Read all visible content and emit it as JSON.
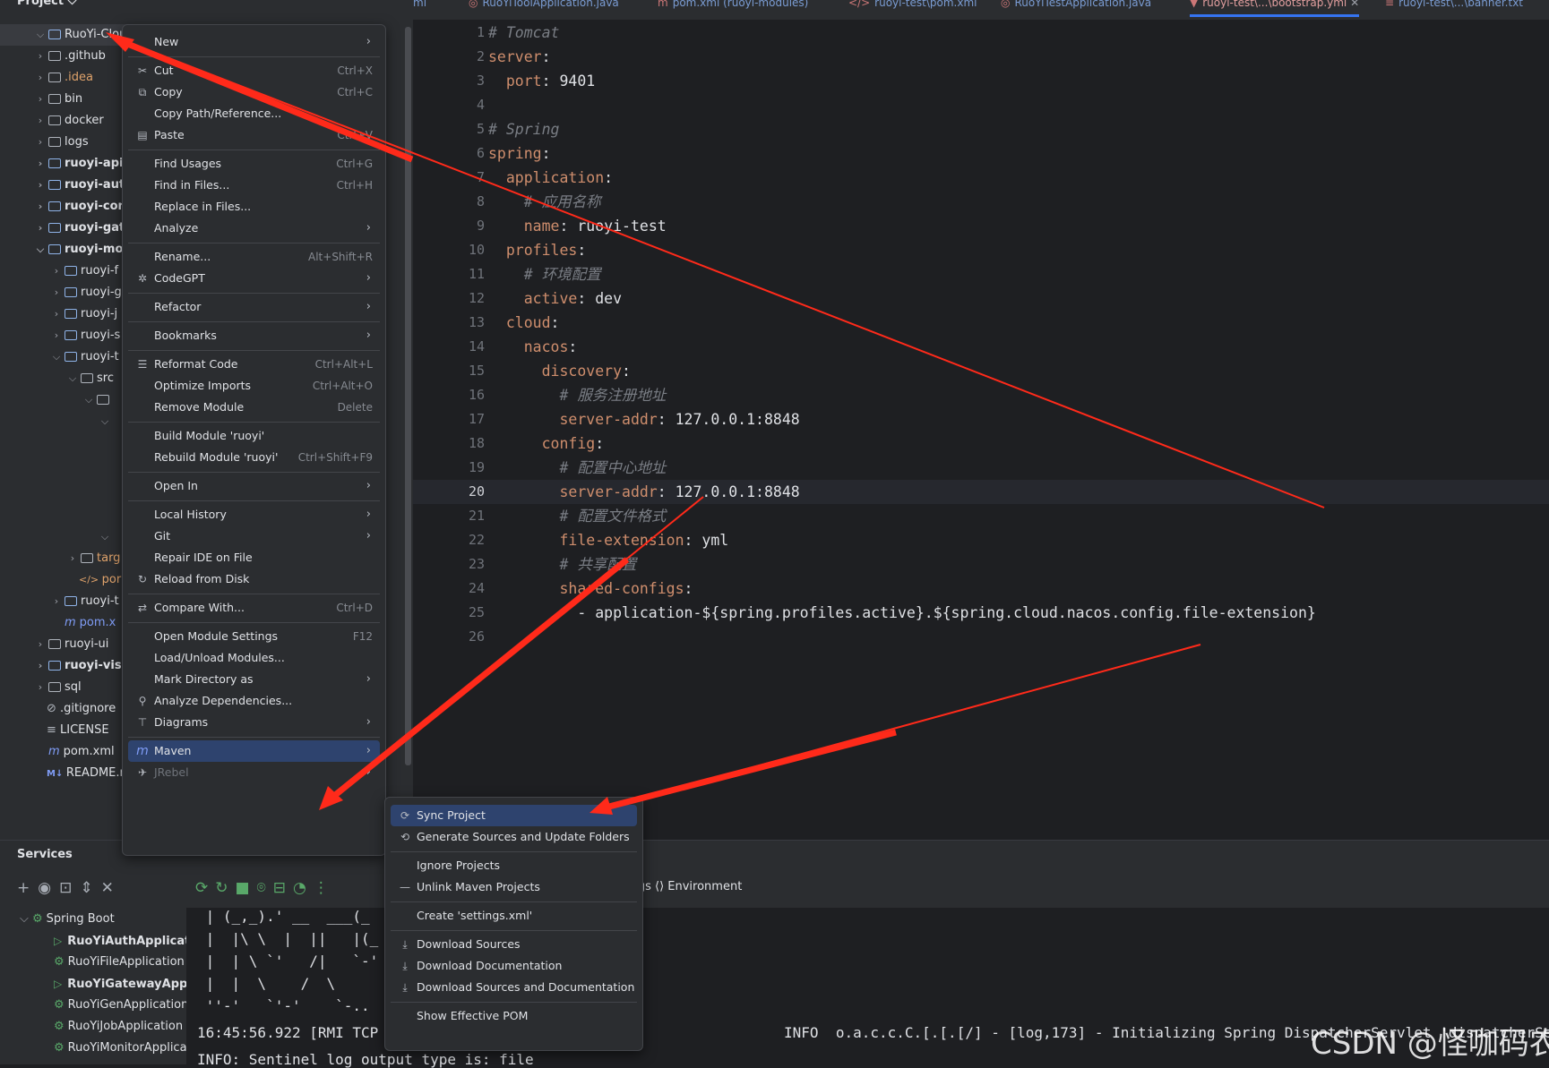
{
  "project": {
    "header": "Project",
    "tree": [
      {
        "label": "RuoYi-Cloud",
        "chev": "⌵",
        "bold": false,
        "type": "mod"
      },
      {
        "label": ".github",
        "chev": "›",
        "type": "dir"
      },
      {
        "label": ".idea",
        "chev": "›",
        "type": "dir",
        "color": "#e0a36b"
      },
      {
        "label": "bin",
        "chev": "›",
        "type": "dir"
      },
      {
        "label": "docker",
        "chev": "›",
        "type": "dir"
      },
      {
        "label": "logs",
        "chev": "›",
        "type": "dir"
      },
      {
        "label": "ruoyi-api",
        "chev": "›",
        "type": "mod",
        "bold": true
      },
      {
        "label": "ruoyi-aut",
        "chev": "›",
        "type": "mod",
        "bold": true
      },
      {
        "label": "ruoyi-con",
        "chev": "›",
        "type": "mod",
        "bold": true
      },
      {
        "label": "ruoyi-gat",
        "chev": "›",
        "type": "mod",
        "bold": true
      },
      {
        "label": "ruoyi-mo",
        "chev": "⌵",
        "type": "mod",
        "bold": true
      },
      {
        "label": "ruoyi-f",
        "chev": "›",
        "type": "mod",
        "indent": 1
      },
      {
        "label": "ruoyi-g",
        "chev": "›",
        "type": "mod",
        "indent": 1
      },
      {
        "label": "ruoyi-j",
        "chev": "›",
        "type": "mod",
        "indent": 1
      },
      {
        "label": "ruoyi-s",
        "chev": "›",
        "type": "mod",
        "indent": 1
      },
      {
        "label": "ruoyi-t",
        "chev": "⌵",
        "type": "mod",
        "indent": 1
      },
      {
        "label": "src",
        "chev": "⌵",
        "type": "dir",
        "indent": 2
      },
      {
        "label": "",
        "chev": "⌵",
        "type": "dir",
        "indent": 3
      },
      {
        "label": "",
        "chev": "⌵",
        "type": "none",
        "indent": 4
      }
    ],
    "tree_lower": [
      {
        "label": "",
        "chev": "⌵",
        "type": "none",
        "indent": 4
      },
      {
        "label": "targ",
        "chev": "›",
        "type": "dir",
        "indent": 2,
        "color": "#e0a36b"
      },
      {
        "label": "por",
        "chev": "",
        "type": "xml",
        "indent": 2,
        "color": "#e0a36b"
      },
      {
        "label": "ruoyi-t",
        "chev": "›",
        "type": "mod",
        "indent": 1
      },
      {
        "label": "pom.x",
        "chev": "",
        "type": "mvn",
        "indent": 1,
        "color": "#7f9cf5"
      },
      {
        "label": "ruoyi-ui",
        "chev": "›",
        "type": "dir"
      },
      {
        "label": "ruoyi-visu",
        "chev": "›",
        "type": "mod",
        "bold": true
      },
      {
        "label": "sql",
        "chev": "›",
        "type": "dir"
      },
      {
        "label": ".gitignore",
        "chev": "",
        "type": "ignore"
      },
      {
        "label": "LICENSE",
        "chev": "",
        "type": "text"
      },
      {
        "label": "pom.xml",
        "chev": "",
        "type": "mvn"
      },
      {
        "label": "README.r",
        "chev": "",
        "type": "md"
      }
    ]
  },
  "tabs": [
    {
      "label": "ml",
      "icon": ""
    },
    {
      "label": "RuoYiToolApplication.java",
      "icon": "◎"
    },
    {
      "label": "pom.xml (ruoyi-modules)",
      "icon": "m"
    },
    {
      "label": "ruoyi-test\\pom.xml",
      "icon": "</>"
    },
    {
      "label": "RuoYiTestApplication.java",
      "icon": "◎"
    },
    {
      "label": "ruoyi-test\\...\\bootstrap.yml",
      "icon": "▼",
      "active": true
    },
    {
      "label": "ruoyi-test\\...\\banner.txt",
      "icon": "≡"
    }
  ],
  "editor": {
    "current_line": "20",
    "lines": [
      [
        {
          "t": "# Tomcat",
          "c": "c"
        }
      ],
      [
        {
          "t": "server",
          "c": "k"
        },
        {
          "t": ":",
          "c": "v"
        }
      ],
      [
        {
          "t": "  port",
          "c": "k"
        },
        {
          "t": ": 9401",
          "c": "v"
        }
      ],
      [],
      [
        {
          "t": "# Spring",
          "c": "c"
        }
      ],
      [
        {
          "t": "spring",
          "c": "k"
        },
        {
          "t": ":",
          "c": "v"
        }
      ],
      [
        {
          "t": "  application",
          "c": "k"
        },
        {
          "t": ":",
          "c": "v"
        }
      ],
      [
        {
          "t": "    # 应用名称",
          "c": "c"
        }
      ],
      [
        {
          "t": "    name",
          "c": "k"
        },
        {
          "t": ": ruoyi-test",
          "c": "v"
        }
      ],
      [
        {
          "t": "  profiles",
          "c": "k"
        },
        {
          "t": ":",
          "c": "v"
        }
      ],
      [
        {
          "t": "    # 环境配置",
          "c": "c"
        }
      ],
      [
        {
          "t": "    active",
          "c": "k"
        },
        {
          "t": ": dev",
          "c": "v"
        }
      ],
      [
        {
          "t": "  cloud",
          "c": "k"
        },
        {
          "t": ":",
          "c": "v"
        }
      ],
      [
        {
          "t": "    nacos",
          "c": "k"
        },
        {
          "t": ":",
          "c": "v"
        }
      ],
      [
        {
          "t": "      discovery",
          "c": "k"
        },
        {
          "t": ":",
          "c": "v"
        }
      ],
      [
        {
          "t": "        # 服务注册地址",
          "c": "c"
        }
      ],
      [
        {
          "t": "        server-addr",
          "c": "k"
        },
        {
          "t": ": 127.0.0.1:8848",
          "c": "v"
        }
      ],
      [
        {
          "t": "      config",
          "c": "k"
        },
        {
          "t": ":",
          "c": "v"
        }
      ],
      [
        {
          "t": "        # 配置中心地址",
          "c": "c"
        }
      ],
      [
        {
          "t": "        server-addr",
          "c": "k"
        },
        {
          "t": ": 127.0.0.1:8848",
          "c": "v"
        }
      ],
      [
        {
          "t": "        # 配置文件格式",
          "c": "c"
        }
      ],
      [
        {
          "t": "        file-extension",
          "c": "k"
        },
        {
          "t": ": yml",
          "c": "v"
        }
      ],
      [
        {
          "t": "        # 共享配置",
          "c": "c"
        }
      ],
      [
        {
          "t": "        shared-configs",
          "c": "k"
        },
        {
          "t": ":",
          "c": "v"
        }
      ],
      [
        {
          "t": "          - application-${spring.profiles.active}.${spring.cloud.nacos.config.file-extension}",
          "c": "v"
        }
      ],
      []
    ]
  },
  "context_menu": {
    "items": [
      {
        "label": "New",
        "sub": true
      },
      {
        "sep": true
      },
      {
        "label": "Cut",
        "icon": "✂",
        "sc": "Ctrl+X"
      },
      {
        "label": "Copy",
        "icon": "⧉",
        "sc": "Ctrl+C"
      },
      {
        "label": "Copy Path/Reference..."
      },
      {
        "label": "Paste",
        "icon": "▤",
        "sc": "Ctrl+V"
      },
      {
        "sep": true
      },
      {
        "label": "Find Usages",
        "sc": "Ctrl+G"
      },
      {
        "label": "Find in Files...",
        "sc": "Ctrl+H"
      },
      {
        "label": "Replace in Files..."
      },
      {
        "label": "Analyze",
        "sub": true
      },
      {
        "sep": true
      },
      {
        "label": "Rename...",
        "sc": "Alt+Shift+R"
      },
      {
        "label": "CodeGPT",
        "icon": "✲",
        "sub": true
      },
      {
        "sep": true
      },
      {
        "label": "Refactor",
        "sub": true
      },
      {
        "sep": true
      },
      {
        "label": "Bookmarks",
        "sub": true
      },
      {
        "sep": true
      },
      {
        "label": "Reformat Code",
        "icon": "☰",
        "sc": "Ctrl+Alt+L"
      },
      {
        "label": "Optimize Imports",
        "sc": "Ctrl+Alt+O"
      },
      {
        "label": "Remove Module",
        "sc": "Delete"
      },
      {
        "sep": true
      },
      {
        "label": "Build Module 'ruoyi'"
      },
      {
        "label": "Rebuild Module 'ruoyi'",
        "sc": "Ctrl+Shift+F9"
      },
      {
        "sep": true
      },
      {
        "label": "Open In",
        "sub": true
      },
      {
        "sep": true
      },
      {
        "label": "Local History",
        "sub": true
      },
      {
        "label": "Git",
        "sub": true
      },
      {
        "label": "Repair IDE on File"
      },
      {
        "label": "Reload from Disk",
        "icon": "↻"
      },
      {
        "sep": true
      },
      {
        "label": "Compare With...",
        "icon": "⇄",
        "sc": "Ctrl+D"
      },
      {
        "sep": true
      },
      {
        "label": "Open Module Settings",
        "sc": "F12"
      },
      {
        "label": "Load/Unload Modules..."
      },
      {
        "label": "Mark Directory as",
        "sub": true
      },
      {
        "label": "Analyze Dependencies...",
        "icon": "⚲"
      },
      {
        "label": "Diagrams",
        "icon": "⊤",
        "sub": true
      },
      {
        "sep": true
      },
      {
        "label": "Maven",
        "icon": "m",
        "sub": true,
        "selected": true
      },
      {
        "label": "JRebel",
        "icon": "✈",
        "sub": true,
        "disabled": true
      }
    ]
  },
  "maven_menu": {
    "items": [
      {
        "label": "Sync Project",
        "icon": "⟳",
        "selected": true
      },
      {
        "label": "Generate Sources and Update Folders",
        "icon": "⟲"
      },
      {
        "sep": true
      },
      {
        "label": "Ignore Projects"
      },
      {
        "label": "Unlink Maven Projects",
        "icon": "—"
      },
      {
        "sep": true
      },
      {
        "label": "Create 'settings.xml'"
      },
      {
        "sep": true
      },
      {
        "label": "Download Sources",
        "icon": "⤓"
      },
      {
        "label": "Download Documentation",
        "icon": "⤓"
      },
      {
        "label": "Download Sources and Documentation",
        "icon": "⤓"
      },
      {
        "sep": true
      },
      {
        "label": "Show Effective POM"
      }
    ]
  },
  "services": {
    "title": "Services",
    "toolbar": "+◉⊡⇕✕",
    "toolbar2": "⟳↻■⌾⊟◔⋮",
    "tabs_text": "ings   ⟨⟩ Environment",
    "tree": [
      {
        "label": "Spring Boot",
        "chev": "⌵",
        "kind": "group"
      },
      {
        "label": "RuoYiAuthApplicatio",
        "kind": "run",
        "bold": true
      },
      {
        "label": "RuoYiFileApplication",
        "kind": "idle"
      },
      {
        "label": "RuoYiGatewayApplic",
        "kind": "run",
        "bold": true
      },
      {
        "label": "RuoYiGenApplication",
        "kind": "idle"
      },
      {
        "label": "RuoYiJobApplication",
        "kind": "idle"
      },
      {
        "label": "RuoYiMonitorApplicati",
        "kind": "idle"
      }
    ],
    "console": [
      " | (_,_).' __  ___(_",
      " |  |\\ \\  |  ||   |(_",
      " |  | \\ `'   /|   `-'",
      " |  |  \\    /  \\",
      " ''-'   `'-'    `-..",
      "16:45:56.922 [RMI TCP                                               INFO  o.a.c.c.C.[.[.[/] - [log,173] - Initializing Spring DispatcherServlet 'dispatcherServlet'",
      "INFO: Sentinel log output type is: file"
    ]
  },
  "watermark": "CSDN @怪咖码农",
  "colors": {
    "arrow": "#ff2a1a",
    "selection": "#2e436e",
    "accent": "#3574f0"
  }
}
